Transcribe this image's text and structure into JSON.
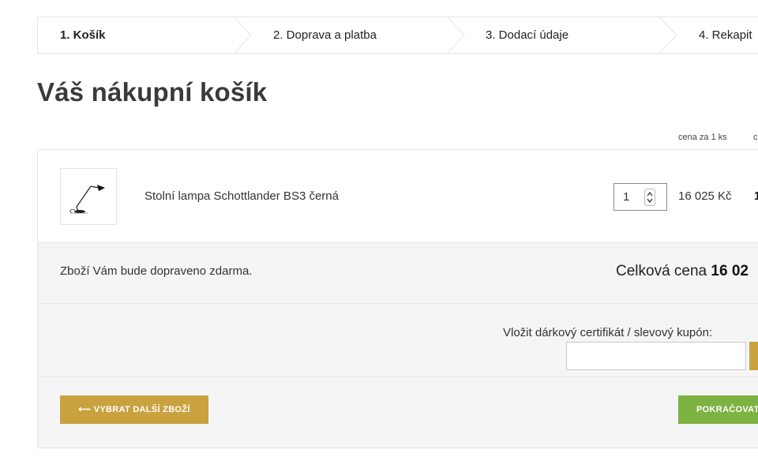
{
  "steps": [
    {
      "label": "1. Košík",
      "active": true
    },
    {
      "label": "2. Doprava a platba",
      "active": false
    },
    {
      "label": "3. Dodací údaje",
      "active": false
    },
    {
      "label": "4. Rekapit",
      "active": false
    }
  ],
  "page_title": "Váš nákupní košík",
  "columns": {
    "unit_price": "cena za 1 ks",
    "total": "c"
  },
  "item": {
    "name": "Stolní lampa Schottlander BS3 černá",
    "quantity": "1",
    "unit_price": "16 025 Kč",
    "total": "1",
    "thumbnail_icon": "desk-lamp-icon"
  },
  "shipping_note": "Zboží Vám bude dopraveno zdarma.",
  "grand_total": {
    "label": "Celková cena",
    "value": "16 02"
  },
  "coupon": {
    "label": "Vložit dárkový certifikát / slevový kupón:",
    "value": ""
  },
  "actions": {
    "back_label": "⟵  VYBRAT DALŠÍ ZBOŽÍ",
    "next_label": "POKRAČOVAT"
  },
  "colors": {
    "gold": "#c9a13f",
    "green": "#7cb342",
    "border": "#e6e6e6",
    "panel": "#f5f5f5"
  }
}
